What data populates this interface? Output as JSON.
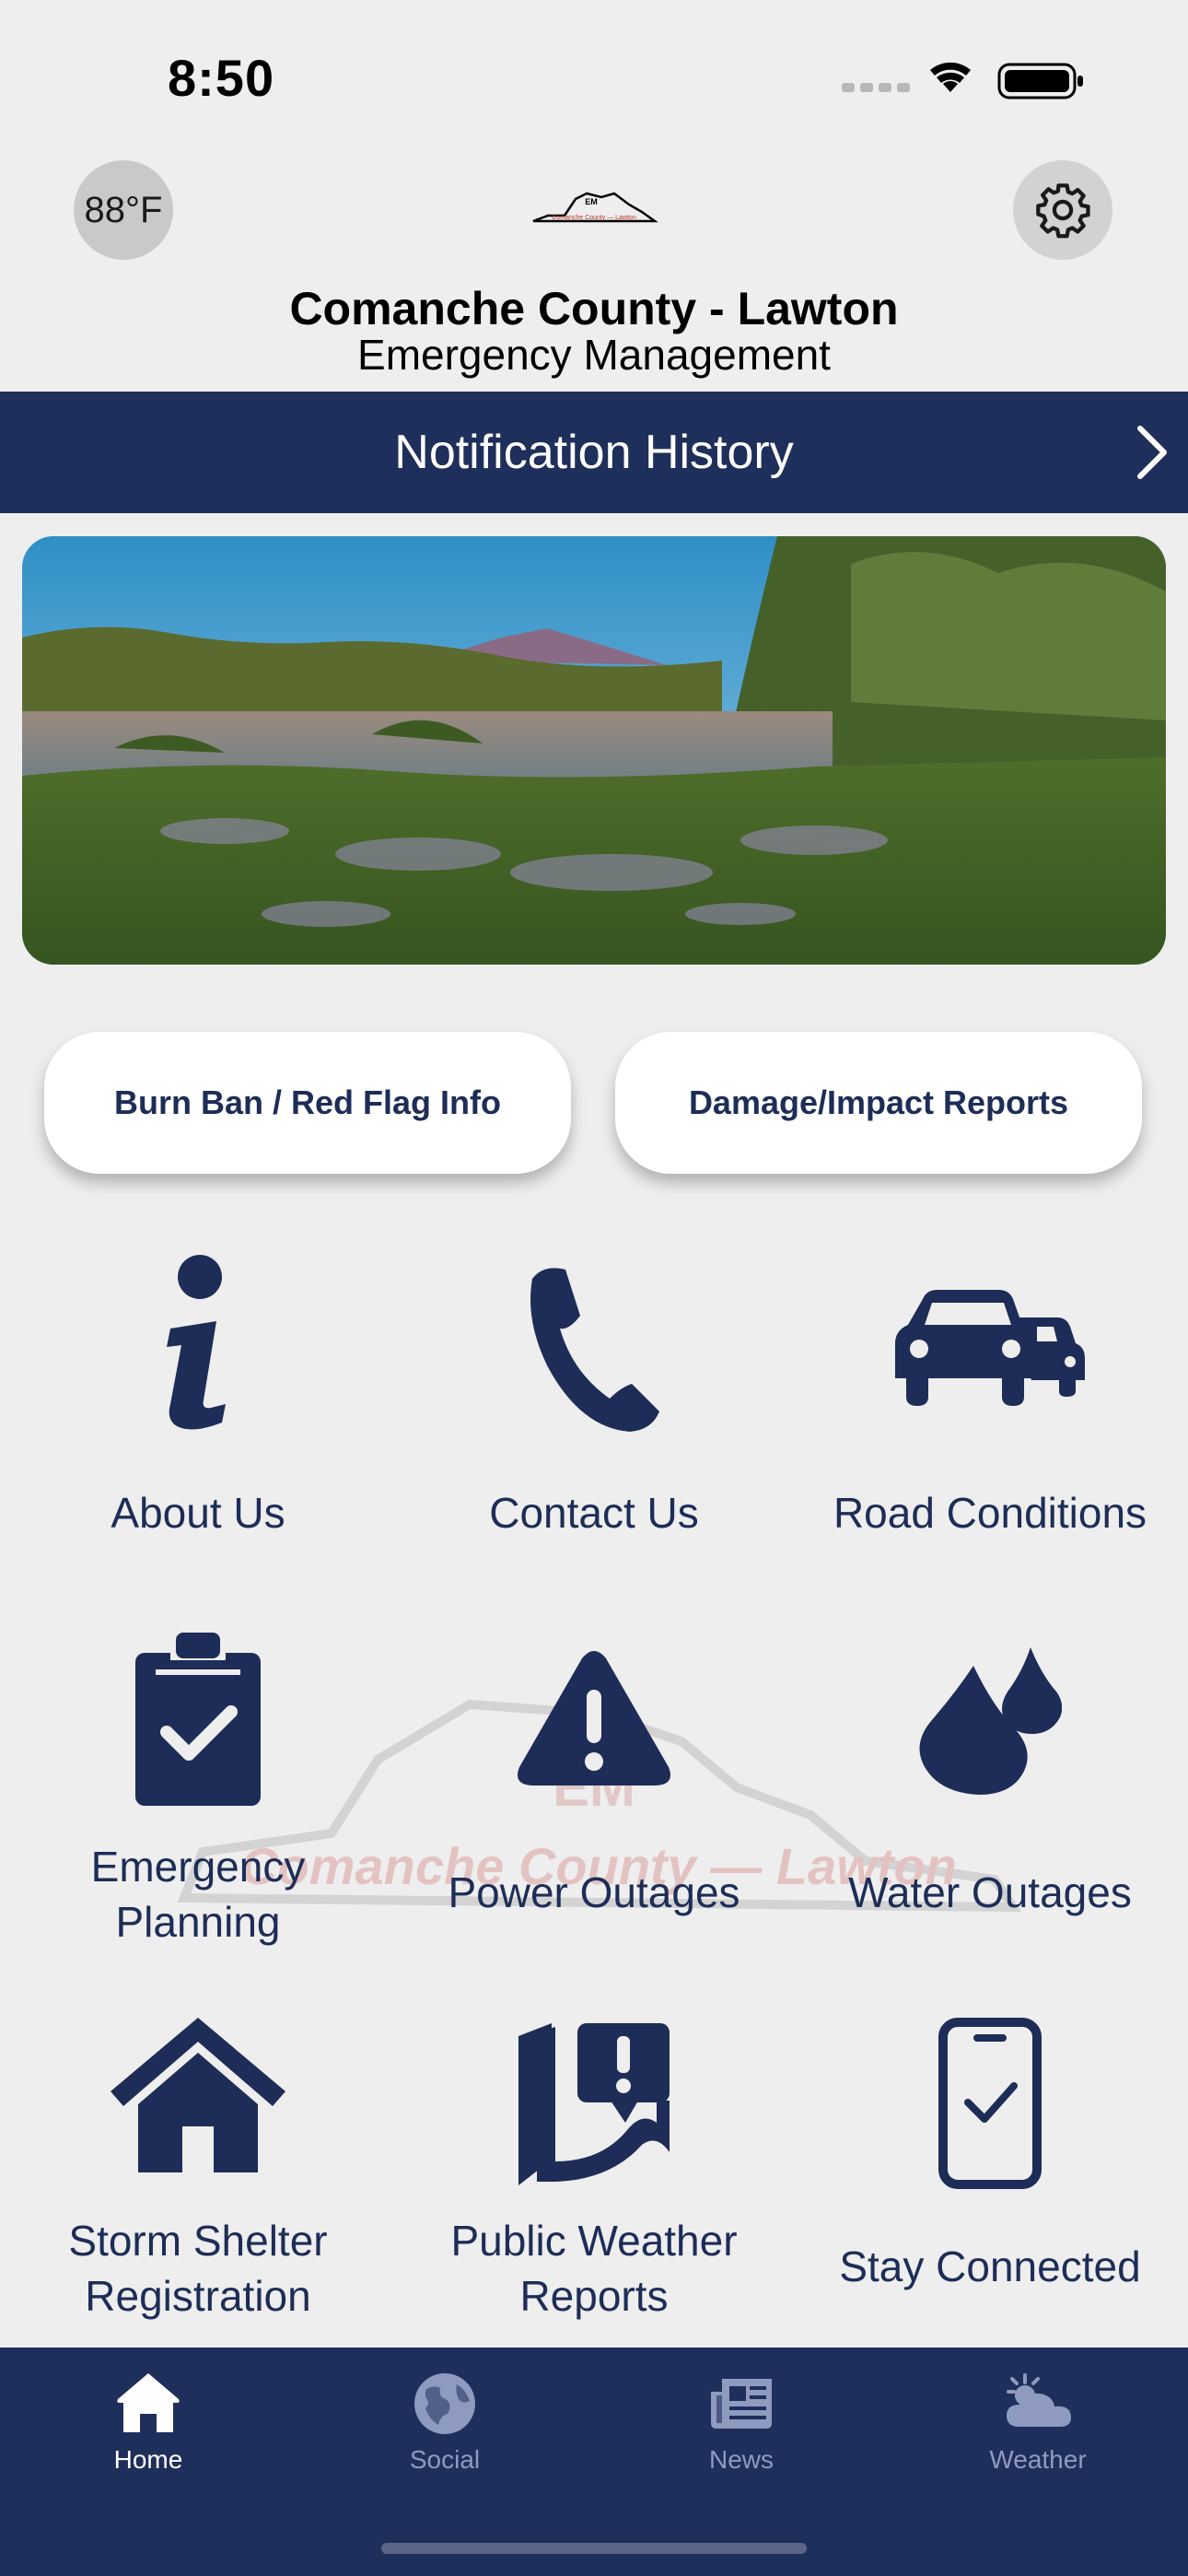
{
  "status_bar": {
    "time": "8:50"
  },
  "header": {
    "temperature": "88°F",
    "logo_text": "Comanche County — Lawton",
    "logo_initials": "EM",
    "title": "Comanche County - Lawton",
    "subtitle": "Emergency Management"
  },
  "notification_bar": {
    "label": "Notification History"
  },
  "quick_buttons": [
    {
      "label": "Burn Ban / Red Flag Info"
    },
    {
      "label": "Damage/Impact Reports"
    }
  ],
  "grid": [
    {
      "label": "About Us",
      "icon": "info-icon"
    },
    {
      "label": "Contact Us",
      "icon": "phone-icon"
    },
    {
      "label": "Road Conditions",
      "icon": "cars-icon"
    },
    {
      "label": "Emergency\nPlanning",
      "icon": "clipboard-check-icon"
    },
    {
      "label": "Power Outages",
      "icon": "warning-icon"
    },
    {
      "label": "Water Outages",
      "icon": "water-drops-icon"
    },
    {
      "label": "Storm Shelter\nRegistration",
      "icon": "house-icon"
    },
    {
      "label": "Public Weather\nReports",
      "icon": "map-alert-icon"
    },
    {
      "label": "Stay Connected",
      "icon": "phone-check-icon"
    }
  ],
  "watermark_text": "Comanche County — Lawton",
  "tabs": [
    {
      "label": "Home",
      "icon": "home-icon",
      "active": true
    },
    {
      "label": "Social",
      "icon": "globe-icon",
      "active": false
    },
    {
      "label": "News",
      "icon": "newspaper-icon",
      "active": false
    },
    {
      "label": "Weather",
      "icon": "cloud-sun-icon",
      "active": false
    }
  ],
  "colors": {
    "navy": "#1f2f5b",
    "text_navy": "#1d2d57",
    "background": "#eeeeee",
    "inactive_tab": "#8f9ac0"
  }
}
